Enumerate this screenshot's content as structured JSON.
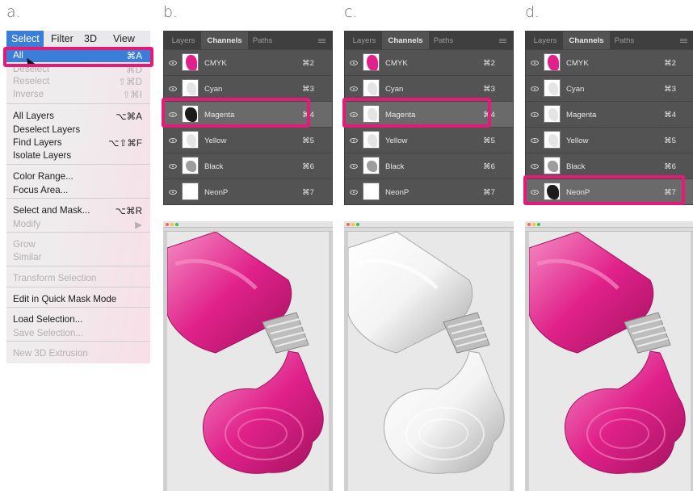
{
  "figure_labels": [
    "a.",
    "b.",
    "c.",
    "d."
  ],
  "menu": {
    "menubar": [
      "Select",
      "Filter",
      "3D",
      "View"
    ],
    "items": [
      {
        "label": "All",
        "shortcut": "⌘A",
        "state": "highlighted"
      },
      {
        "label": "Deselect",
        "shortcut": "⌘D",
        "state": "disabled"
      },
      {
        "label": "Reselect",
        "shortcut": "⇧⌘D",
        "state": "disabled"
      },
      {
        "label": "Inverse",
        "shortcut": "⇧⌘I",
        "state": "disabled"
      },
      {
        "label": "All Layers",
        "shortcut": "⌥⌘A",
        "state": "enabled"
      },
      {
        "label": "Deselect Layers",
        "shortcut": "",
        "state": "enabled"
      },
      {
        "label": "Find Layers",
        "shortcut": "⌥⇧⌘F",
        "state": "enabled"
      },
      {
        "label": "Isolate Layers",
        "shortcut": "",
        "state": "enabled"
      },
      {
        "label": "Color Range...",
        "shortcut": "",
        "state": "enabled"
      },
      {
        "label": "Focus Area...",
        "shortcut": "",
        "state": "enabled"
      },
      {
        "label": "Select and Mask...",
        "shortcut": "⌥⌘R",
        "state": "enabled"
      },
      {
        "label": "Modify",
        "shortcut": "▶",
        "state": "disabled"
      },
      {
        "label": "Grow",
        "shortcut": "",
        "state": "disabled"
      },
      {
        "label": "Similar",
        "shortcut": "",
        "state": "disabled"
      },
      {
        "label": "Transform Selection",
        "shortcut": "",
        "state": "disabled"
      },
      {
        "label": "Edit in Quick Mask Mode",
        "shortcut": "",
        "state": "enabled"
      },
      {
        "label": "Load Selection...",
        "shortcut": "",
        "state": "enabled"
      },
      {
        "label": "Save Selection...",
        "shortcut": "",
        "state": "disabled"
      },
      {
        "label": "New 3D Extrusion",
        "shortcut": "",
        "state": "disabled"
      }
    ]
  },
  "panels": [
    {
      "tabs": [
        "Layers",
        "Channels",
        "Paths"
      ],
      "active_tab": "Channels",
      "channels": [
        {
          "name": "CMYK",
          "shortcut": "⌘2",
          "thumb": "pink"
        },
        {
          "name": "Cyan",
          "shortcut": "⌘3",
          "thumb": "faint"
        },
        {
          "name": "Magenta",
          "shortcut": "⌘4",
          "thumb": "dark"
        },
        {
          "name": "Yellow",
          "shortcut": "⌘5",
          "thumb": "faint"
        },
        {
          "name": "Black",
          "shortcut": "⌘6",
          "thumb": "grey"
        },
        {
          "name": "NeonP",
          "shortcut": "⌘7",
          "thumb": "blank"
        }
      ],
      "highlighted_channel": "Magenta"
    },
    {
      "tabs": [
        "Layers",
        "Channels",
        "Paths"
      ],
      "active_tab": "Channels",
      "channels": [
        {
          "name": "CMYK",
          "shortcut": "⌘2",
          "thumb": "pink"
        },
        {
          "name": "Cyan",
          "shortcut": "⌘3",
          "thumb": "faint"
        },
        {
          "name": "Magenta",
          "shortcut": "⌘4",
          "thumb": "faint"
        },
        {
          "name": "Yellow",
          "shortcut": "⌘5",
          "thumb": "faint"
        },
        {
          "name": "Black",
          "shortcut": "⌘6",
          "thumb": "grey"
        },
        {
          "name": "NeonP",
          "shortcut": "⌘7",
          "thumb": "blank"
        }
      ],
      "highlighted_channel": "Magenta"
    },
    {
      "tabs": [
        "Layers",
        "Channels",
        "Paths"
      ],
      "active_tab": "Channels",
      "channels": [
        {
          "name": "CMYK",
          "shortcut": "⌘2",
          "thumb": "pink"
        },
        {
          "name": "Cyan",
          "shortcut": "⌘3",
          "thumb": "faint"
        },
        {
          "name": "Magenta",
          "shortcut": "⌘4",
          "thumb": "faint"
        },
        {
          "name": "Yellow",
          "shortcut": "⌘5",
          "thumb": "faint"
        },
        {
          "name": "Black",
          "shortcut": "⌘6",
          "thumb": "grey"
        },
        {
          "name": "NeonP",
          "shortcut": "⌘7",
          "thumb": "dark"
        }
      ],
      "highlighted_channel": "NeonP"
    }
  ],
  "previews": [
    {
      "color": "#e0218a",
      "shade": "#a3125f",
      "light": "#f58cc3"
    },
    {
      "color": "#f4f4f4",
      "shade": "#a9a9a9",
      "light": "#ffffff"
    },
    {
      "color": "#e0218a",
      "shade": "#a3125f",
      "light": "#f58cc3"
    }
  ],
  "colors": {
    "highlight_box": "#e31a78",
    "menu_selection": "#3b7ed8",
    "panel_bg": "#535353"
  }
}
